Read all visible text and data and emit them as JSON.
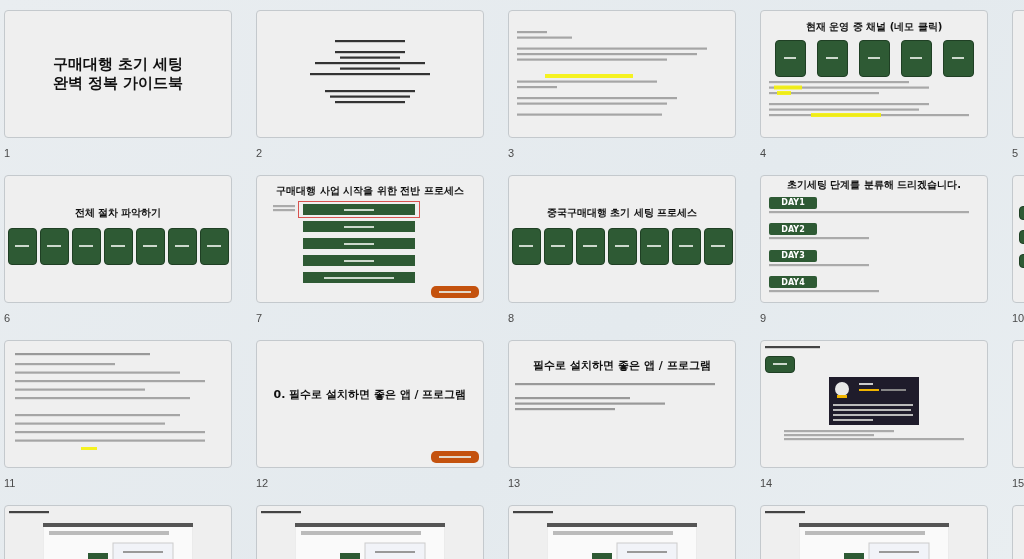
{
  "slides": [
    {
      "number": "1",
      "kind": "cover",
      "title_lines": [
        "구매대행 초기 세팅",
        "완벽 정복 가이드북"
      ]
    },
    {
      "number": "2",
      "kind": "notice"
    },
    {
      "number": "3",
      "kind": "letter"
    },
    {
      "number": "4",
      "kind": "channels",
      "title": "현재 운영 중 채널 (네모 클릭)"
    },
    {
      "number": "5",
      "kind": "partial"
    },
    {
      "number": "6",
      "kind": "steps",
      "title": "전체 절차 파악하기"
    },
    {
      "number": "7",
      "kind": "process",
      "title": "구매대행 사업 시작을 위한 전반 프로세스",
      "link_button": true,
      "rows": [
        {
          "highlighted": true
        },
        {
          "highlighted": false
        },
        {
          "highlighted": false
        },
        {
          "highlighted": false
        },
        {
          "highlighted": false
        }
      ]
    },
    {
      "number": "8",
      "kind": "steps",
      "title": "중국구매대행 초기 세팅 프로세스"
    },
    {
      "number": "9",
      "kind": "days",
      "title": "초기세팅 단계를 분류해 드리겠습니다.",
      "days": [
        "DAY1",
        "DAY2",
        "DAY3",
        "DAY4"
      ]
    },
    {
      "number": "10",
      "kind": "partial-blocks"
    },
    {
      "number": "11",
      "kind": "essay"
    },
    {
      "number": "12",
      "kind": "section",
      "title": "0. 필수로 설치하면 좋은 앱 / 프로그램",
      "link_button": true
    },
    {
      "number": "13",
      "kind": "intro",
      "title": "필수로 설치하면 좋은 앱 / 프로그램"
    },
    {
      "number": "14",
      "kind": "app"
    },
    {
      "number": "15",
      "kind": "partial"
    },
    {
      "kind": "screenshot"
    },
    {
      "kind": "screenshot"
    },
    {
      "kind": "screenshot"
    },
    {
      "kind": "screenshot"
    },
    {
      "kind": "partial"
    }
  ]
}
